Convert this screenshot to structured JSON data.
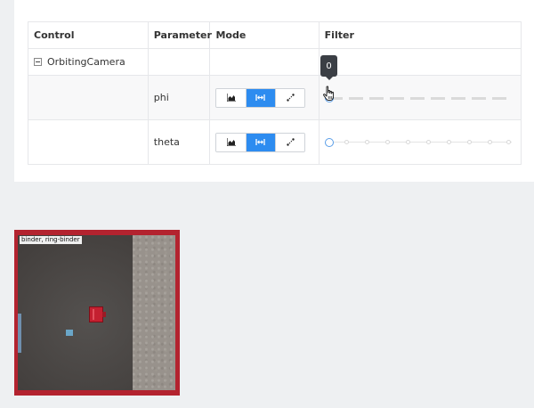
{
  "table": {
    "headers": {
      "control": "Control",
      "parameter": "Parameter",
      "mode": "Mode",
      "filter": "Filter"
    },
    "group": {
      "name": "OrbitingCamera",
      "collapsed": false
    },
    "rows": [
      {
        "parameter": "phi",
        "mode_selected": "sweep",
        "filter_style": "dashed",
        "filter_value": 0
      },
      {
        "parameter": "theta",
        "mode_selected": "sweep",
        "filter_style": "dotted",
        "filter_value": 0
      }
    ],
    "mode_options": [
      "histogram-icon",
      "sweep-icon",
      "scatter-icon"
    ]
  },
  "tooltip": {
    "text": "0"
  },
  "viewport": {
    "label": "binder, ring-binder",
    "frame_color": "#b3232f"
  },
  "colors": {
    "accent": "#2d8cf0",
    "slider_handle": "#5a9ee8"
  }
}
